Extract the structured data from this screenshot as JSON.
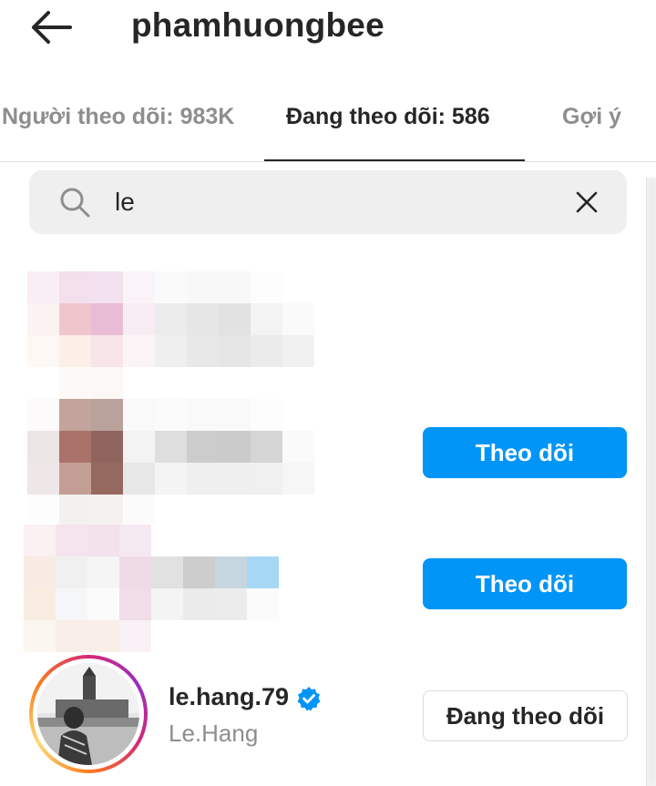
{
  "header": {
    "username": "phamhuongbee"
  },
  "tabs": [
    {
      "label": "Người theo dõi: 983K"
    },
    {
      "label": "Đang theo dõi: 586"
    },
    {
      "label": "Gợi ý"
    }
  ],
  "search": {
    "value": "le"
  },
  "rows": [
    {
      "button_label": "Theo dõi"
    },
    {
      "button_label": "Theo dõi"
    },
    {
      "username": "le.hang.79",
      "full_name": "Le.Hang",
      "button_label": "Đang theo dõi"
    }
  ],
  "colors": {
    "accent": "#0095f6",
    "verified": "#0095f6",
    "text": "#262626",
    "secondary_text": "#8e8e8e",
    "search_bg": "#efefef"
  },
  "icons": [
    "back-arrow-icon",
    "search-icon",
    "clear-icon",
    "verified-badge-icon"
  ]
}
